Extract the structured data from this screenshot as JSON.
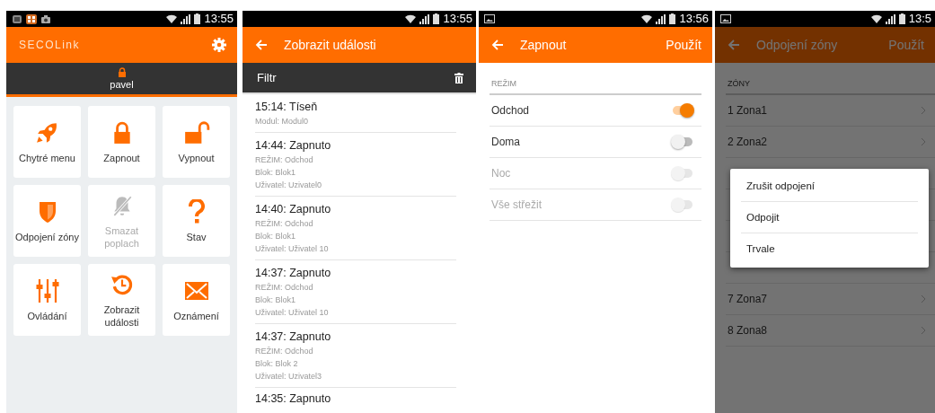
{
  "screens": [
    {
      "kind": "home",
      "status": {
        "time": "13:55"
      },
      "logo": "SECOLink",
      "user": "pavel",
      "tiles": [
        {
          "label": "Chytré menu",
          "disabled": false
        },
        {
          "label": "Zapnout",
          "disabled": false
        },
        {
          "label": "Vypnout",
          "disabled": false
        },
        {
          "label": "Odpojení zóny",
          "disabled": false
        },
        {
          "label": "Smazat poplach",
          "disabled": true
        },
        {
          "label": "Stav",
          "disabled": false
        },
        {
          "label": "Ovládání",
          "disabled": false
        },
        {
          "label": "Zobrazit události",
          "disabled": false
        },
        {
          "label": "Oznámení",
          "disabled": false
        }
      ]
    },
    {
      "kind": "events",
      "status": {
        "time": "13:55"
      },
      "title": "Zobrazit události",
      "filter": "Filtr",
      "events": [
        {
          "title": "15:14: Tíseň",
          "lines": [
            "Modul: Modul0"
          ]
        },
        {
          "title": "14:44: Zapnuto",
          "lines": [
            "REŽIM: Odchod",
            "Blok: Blok1",
            "Uživatel: Uzivatel0"
          ]
        },
        {
          "title": "14:40: Zapnuto",
          "lines": [
            "REŽIM: Odchod",
            "Blok: Blok1",
            "Uživatel: Uživatel 10"
          ]
        },
        {
          "title": "14:37: Zapnuto",
          "lines": [
            "REŽIM: Odchod",
            "Blok: Blok1",
            "Uživatel: Uživatel 10"
          ]
        },
        {
          "title": "14:37: Zapnuto",
          "lines": [
            "REŽIM: Odchod",
            "Blok: Blok 2",
            "Uživatel: Uzivatel3"
          ]
        },
        {
          "title": "14:35: Zapnuto"
        }
      ]
    },
    {
      "kind": "modes",
      "status": {
        "time": "13:56"
      },
      "title": "Zapnout",
      "action": "Použít",
      "section": "REŽIM",
      "options": [
        {
          "label": "Odchod",
          "on": true,
          "disabled": false
        },
        {
          "label": "Doma",
          "on": false,
          "disabled": false
        },
        {
          "label": "Noc",
          "on": false,
          "disabled": true
        },
        {
          "label": "Vše střežit",
          "on": false,
          "disabled": true
        }
      ]
    },
    {
      "kind": "zones",
      "status": {
        "time": "13:5"
      },
      "title": "Odpojení zóny",
      "action": "Použít",
      "section": "ZÓNY",
      "zones_above": [
        {
          "label": "1 Zona1"
        },
        {
          "label": "2 Zona2"
        }
      ],
      "zones_below": [
        {
          "label": "7 Zona7"
        },
        {
          "label": "8 Zona8"
        }
      ],
      "dialog": {
        "options": [
          "Zrušit odpojení",
          "Odpojit",
          "Trvale"
        ]
      }
    }
  ]
}
